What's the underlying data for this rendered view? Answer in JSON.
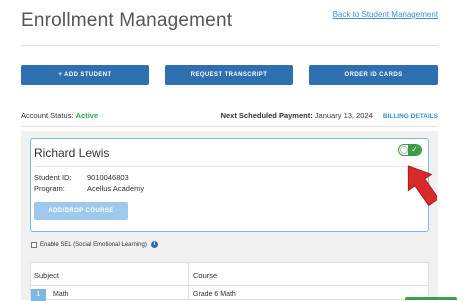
{
  "header": {
    "title": "Enrollment Management",
    "back_link": "Back to Student Management"
  },
  "actions": {
    "add_student": "+ ADD STUDENT",
    "request_transcript": "REQUEST TRANSCRIPT",
    "order_id_cards": "ORDER ID CARDS"
  },
  "account": {
    "status_label": "Account Status:",
    "status_value": "Active",
    "payment_label": "Next Scheduled Payment:",
    "payment_date": "January 13, 2024",
    "billing_details": "BILLING DETAILS"
  },
  "student": {
    "name": "Richard Lewis",
    "id_label": "Student ID:",
    "id_value": "9010046803",
    "program_label": "Program:",
    "program_value": "Acellus Academy",
    "add_drop": "ADD/DROP COURSE",
    "toggle_on": true,
    "toggle_glyph": "✓"
  },
  "sel": {
    "label": "Enable SEL (Social Emotional Learning)",
    "checked": false,
    "info_glyph": "i"
  },
  "table": {
    "headers": {
      "subject": "Subject",
      "course": "Course"
    },
    "rows": [
      {
        "num": "1",
        "subject": "Math",
        "course": "Grade 6 Math"
      }
    ]
  },
  "colors": {
    "primary": "#2e6fb1",
    "link": "#3d8fd1",
    "active": "#2fa84f",
    "arrow": "#d92a2a"
  },
  "icons": {
    "arrow": "red-arrow-pointing-up-left",
    "toggle": "toggle-switch-checkmark",
    "info": "info-circle-icon"
  }
}
